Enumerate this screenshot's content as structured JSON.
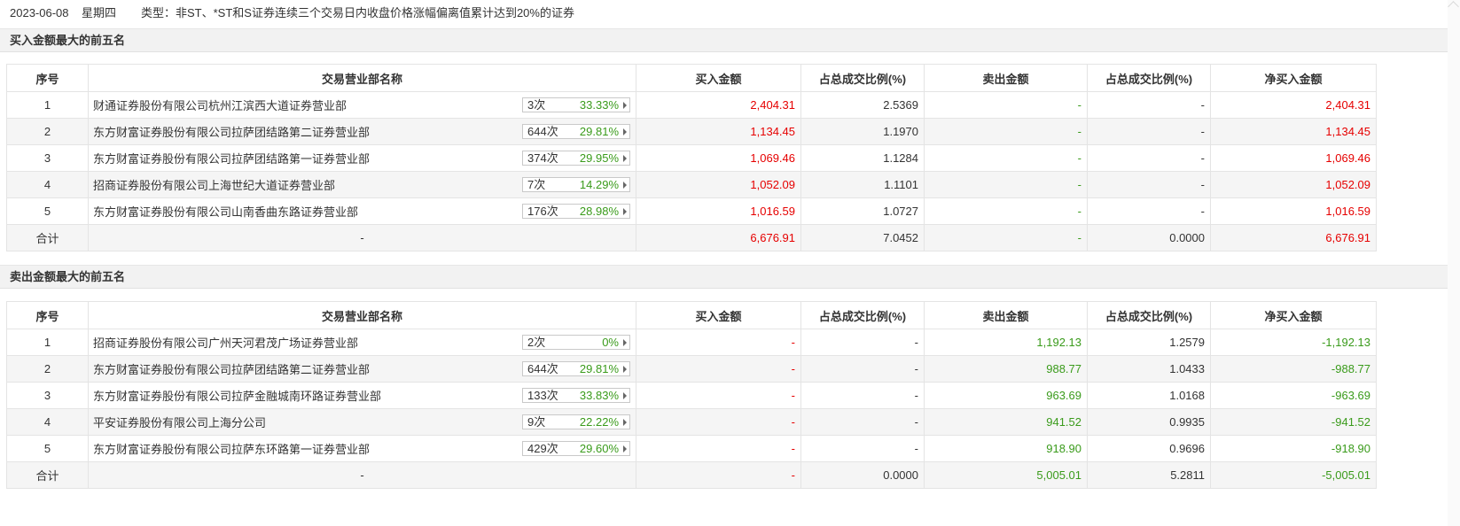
{
  "header": {
    "date": "2023-06-08",
    "weekday": "星期四",
    "type_text": "类型：非ST、*ST和S证券连续三个交易日内收盘价格涨幅偏离值累计达到20%的证券"
  },
  "columns": [
    "序号",
    "交易营业部名称",
    "买入金额",
    "占总成交比例(%)",
    "卖出金额",
    "占总成交比例(%)",
    "净买入金额"
  ],
  "buy_section": {
    "title": "买入金额最大的前五名",
    "rows": [
      {
        "idx": "1",
        "name": "财通证券股份有限公司杭州江滨西大道证券营业部",
        "times": "3次",
        "pct": "33.33%",
        "buy": "2,404.31",
        "buy_ratio": "2.5369",
        "sell": "-",
        "sell_ratio": "-",
        "net": "2,404.31"
      },
      {
        "idx": "2",
        "name": "东方财富证券股份有限公司拉萨团结路第二证券营业部",
        "times": "644次",
        "pct": "29.81%",
        "buy": "1,134.45",
        "buy_ratio": "1.1970",
        "sell": "-",
        "sell_ratio": "-",
        "net": "1,134.45"
      },
      {
        "idx": "3",
        "name": "东方财富证券股份有限公司拉萨团结路第一证券营业部",
        "times": "374次",
        "pct": "29.95%",
        "buy": "1,069.46",
        "buy_ratio": "1.1284",
        "sell": "-",
        "sell_ratio": "-",
        "net": "1,069.46"
      },
      {
        "idx": "4",
        "name": "招商证券股份有限公司上海世纪大道证券营业部",
        "times": "7次",
        "pct": "14.29%",
        "buy": "1,052.09",
        "buy_ratio": "1.1101",
        "sell": "-",
        "sell_ratio": "-",
        "net": "1,052.09"
      },
      {
        "idx": "5",
        "name": "东方财富证券股份有限公司山南香曲东路证券营业部",
        "times": "176次",
        "pct": "28.98%",
        "buy": "1,016.59",
        "buy_ratio": "1.0727",
        "sell": "-",
        "sell_ratio": "-",
        "net": "1,016.59"
      }
    ],
    "total": {
      "label": "合计",
      "name": "-",
      "buy": "6,676.91",
      "buy_ratio": "7.0452",
      "sell": "-",
      "sell_ratio": "0.0000",
      "net": "6,676.91"
    }
  },
  "sell_section": {
    "title": "卖出金额最大的前五名",
    "rows": [
      {
        "idx": "1",
        "name": "招商证券股份有限公司广州天河君茂广场证券营业部",
        "times": "2次",
        "pct": "0%",
        "buy": "-",
        "buy_ratio": "-",
        "sell": "1,192.13",
        "sell_ratio": "1.2579",
        "net": "-1,192.13"
      },
      {
        "idx": "2",
        "name": "东方财富证券股份有限公司拉萨团结路第二证券营业部",
        "times": "644次",
        "pct": "29.81%",
        "buy": "-",
        "buy_ratio": "-",
        "sell": "988.77",
        "sell_ratio": "1.0433",
        "net": "-988.77"
      },
      {
        "idx": "3",
        "name": "东方财富证券股份有限公司拉萨金融城南环路证券营业部",
        "times": "133次",
        "pct": "33.83%",
        "buy": "-",
        "buy_ratio": "-",
        "sell": "963.69",
        "sell_ratio": "1.0168",
        "net": "-963.69"
      },
      {
        "idx": "4",
        "name": "平安证券股份有限公司上海分公司",
        "times": "9次",
        "pct": "22.22%",
        "buy": "-",
        "buy_ratio": "-",
        "sell": "941.52",
        "sell_ratio": "0.9935",
        "net": "-941.52"
      },
      {
        "idx": "5",
        "name": "东方财富证券股份有限公司拉萨东环路第一证券营业部",
        "times": "429次",
        "pct": "29.60%",
        "buy": "-",
        "buy_ratio": "-",
        "sell": "918.90",
        "sell_ratio": "0.9696",
        "net": "-918.90"
      }
    ],
    "total": {
      "label": "合计",
      "name": "-",
      "buy": "-",
      "buy_ratio": "0.0000",
      "sell": "5,005.01",
      "sell_ratio": "5.2811",
      "net": "-5,005.01"
    }
  },
  "colors": {
    "up": "#e60000",
    "down": "#3a9b1b",
    "header_bg": "#f2f2f2",
    "row_alt": "#f5f5f5"
  }
}
